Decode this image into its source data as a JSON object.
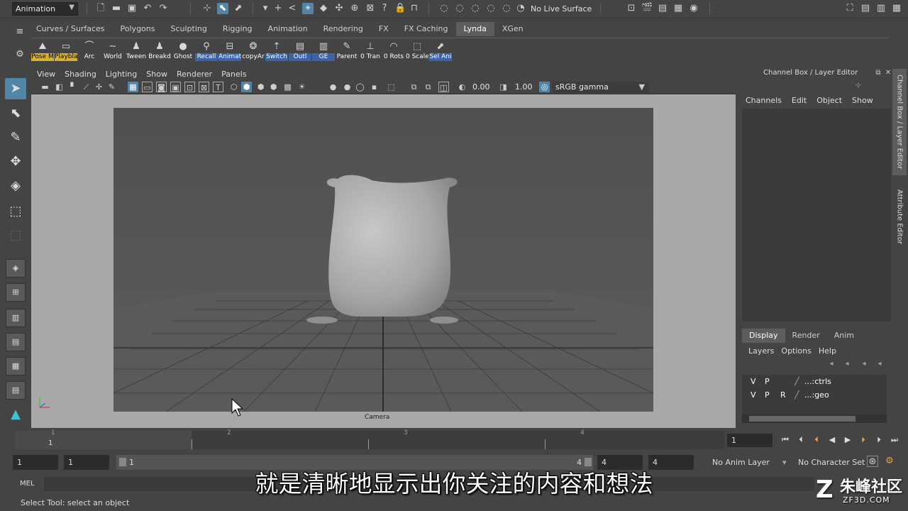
{
  "status_line": {
    "menuset": "Animation",
    "live_surface": "No Live Surface"
  },
  "shelf": {
    "tabs": [
      "Curves / Surfaces",
      "Polygons",
      "Sculpting",
      "Rigging",
      "Animation",
      "Rendering",
      "FX",
      "FX Caching",
      "Lynda",
      "XGen"
    ],
    "active_tab": "Lynda",
    "buttons": [
      "Pose M",
      "Playbla",
      "Arc",
      "World",
      "Tween",
      "Breakd",
      "Ghost",
      "Recall",
      "Animat",
      "copyAr",
      "Switch",
      "Outl",
      "GE",
      "Parent",
      "0 Tran",
      "0 Rots",
      "0 Scale",
      "Sel Ani"
    ]
  },
  "panel": {
    "menus": [
      "View",
      "Shading",
      "Lighting",
      "Show",
      "Renderer",
      "Panels"
    ],
    "exposure": "0.00",
    "gamma_value": "1.00",
    "color_space": "sRGB gamma",
    "camera_label": "Camera"
  },
  "channel_box": {
    "title": "Channel Box / Layer Editor",
    "menus": [
      "Channels",
      "Edit",
      "Object",
      "Show"
    ]
  },
  "side_tabs": [
    "Channel Box / Layer Editor",
    "Attribute Editor"
  ],
  "layer_editor": {
    "tabs": [
      "Display",
      "Render",
      "Anim"
    ],
    "active_tab": "Display",
    "menus": [
      "Layers",
      "Options",
      "Help"
    ],
    "layers": [
      {
        "v": "V",
        "p": "P",
        "r": "",
        "name": "...:ctrls"
      },
      {
        "v": "V",
        "p": "P",
        "r": "R",
        "name": "...:geo"
      }
    ]
  },
  "time_slider": {
    "ticks": [
      "1",
      "2",
      "3",
      "4"
    ],
    "current_frame_label": "1",
    "current_frame": "1"
  },
  "range_slider": {
    "start": "1",
    "playback_start": "1",
    "range_start": "1",
    "range_end": "4",
    "playback_end": "4",
    "end": "4",
    "anim_layer": "No Anim Layer",
    "character_set": "No Character Set"
  },
  "command_line": {
    "label": "MEL"
  },
  "help_line": "Select Tool: select an object",
  "subtitle": "就是清晰地显示出你关注的内容和想法",
  "watermark": {
    "name": "朱峰社区",
    "url": "ZF3D.COM"
  }
}
